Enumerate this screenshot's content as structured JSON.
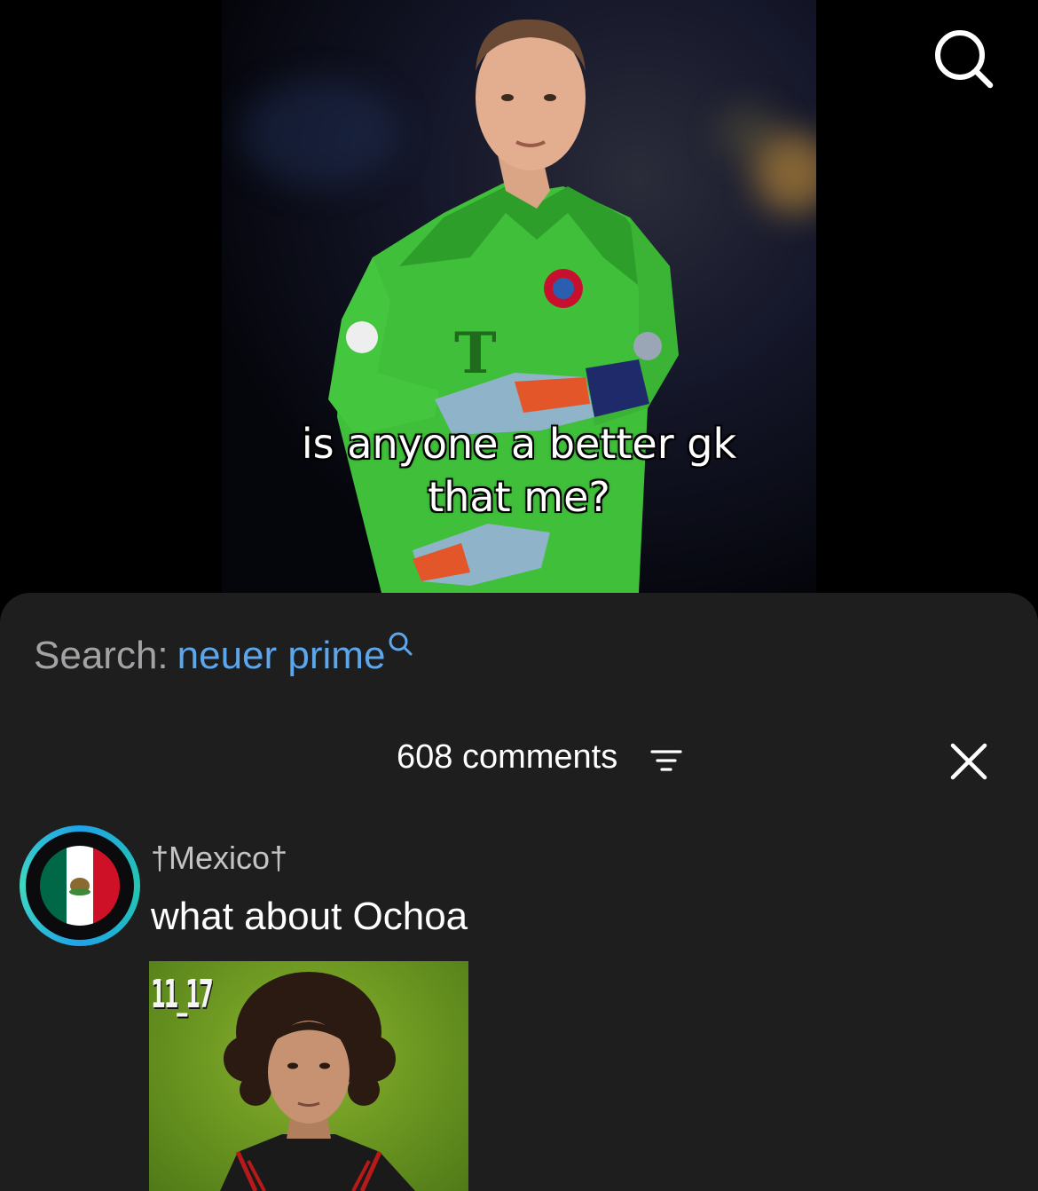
{
  "video": {
    "caption_lines": [
      "is anyone a better gk",
      "that me?"
    ],
    "top_search_icon": "search-icon"
  },
  "search": {
    "label": "Search:",
    "query": "neuer prime",
    "icon": "search-icon"
  },
  "comments_header": {
    "count_label": "608 comments",
    "sort_icon": "sort-filter-icon",
    "close_icon": "close-icon"
  },
  "comments": [
    {
      "username": "†Mexico†",
      "text": "what about Ochoa",
      "avatar": "mexico-flag-avatar",
      "image_tag": "11_17"
    }
  ],
  "colors": {
    "sheet_background": "#1e1e1f",
    "search_query": "#5ca6ec",
    "search_label": "#a3a3a6",
    "username": "#c4c4c6"
  }
}
